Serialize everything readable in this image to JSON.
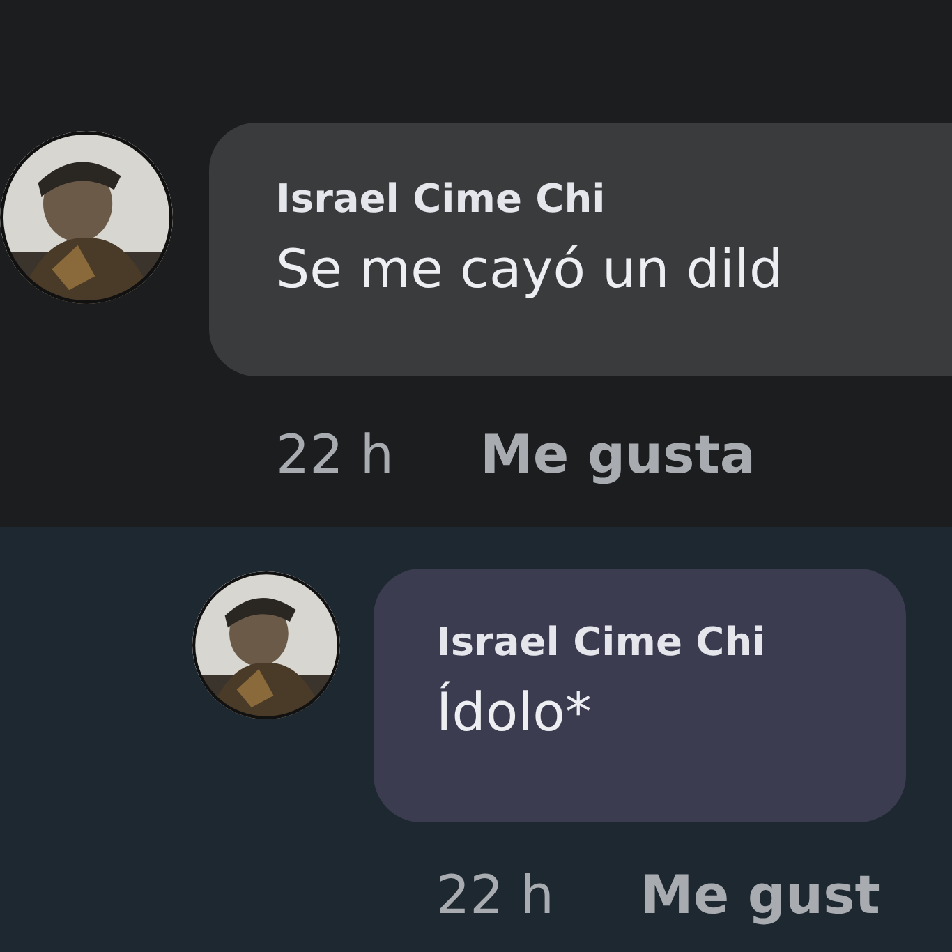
{
  "comments": [
    {
      "author": "Israel Cime Chi",
      "text": "Se me cayó un dild",
      "time": "22 h",
      "actions": [
        "Me gusta"
      ],
      "reply": false
    },
    {
      "author": "Israel Cime Chi",
      "text": "Ídolo*",
      "time": "22 h",
      "actions": [
        "Me gust"
      ],
      "reply": true
    }
  ]
}
